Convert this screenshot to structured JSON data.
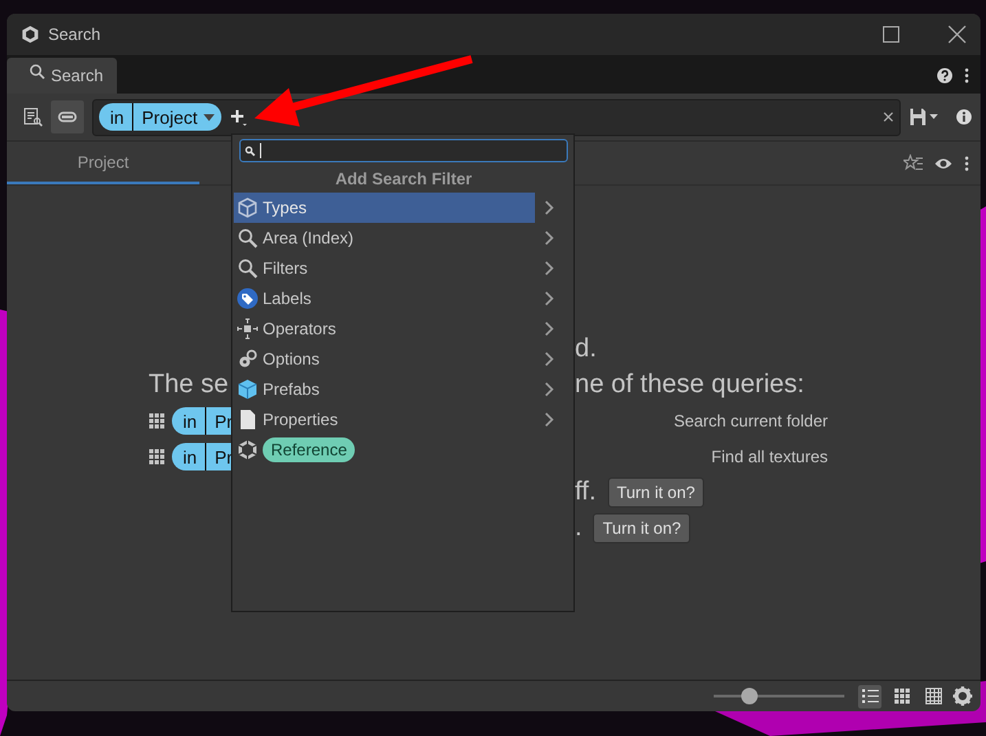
{
  "window": {
    "title": "Search"
  },
  "tabs": [
    {
      "label": "Search",
      "selected": true
    }
  ],
  "search_bar": {
    "scope_chip": {
      "prefix": "in",
      "value": "Project"
    }
  },
  "result_tabs": [
    {
      "label": "Project",
      "selected": true
    }
  ],
  "content": {
    "rows": [
      {
        "kind": "text",
        "right": "d."
      },
      {
        "kind": "heading",
        "left": "The se",
        "right": "ne of these queries:"
      },
      {
        "kind": "query",
        "chip_prefix": "in",
        "chip_value": "Pr",
        "right": "Search current folder"
      },
      {
        "kind": "query",
        "chip_prefix": "in",
        "chip_value": "Pr",
        "right": "Find all textures"
      },
      {
        "kind": "action",
        "right": "ff.",
        "button": "Turn it on?"
      },
      {
        "kind": "action",
        "right": ".",
        "button": "Turn it on?"
      }
    ]
  },
  "filter_menu": {
    "search": {
      "focused": true
    },
    "title": "Add Search Filter",
    "items": [
      {
        "label": "Types",
        "kind": "submenu",
        "selected": true
      },
      {
        "label": "Area (Index)",
        "kind": "submenu",
        "selected": false
      },
      {
        "label": "Filters",
        "kind": "submenu",
        "selected": false
      },
      {
        "label": "Labels",
        "kind": "submenu",
        "selected": false
      },
      {
        "label": "Operators",
        "kind": "submenu",
        "selected": false
      },
      {
        "label": "Options",
        "kind": "submenu",
        "selected": false
      },
      {
        "label": "Prefabs",
        "kind": "submenu",
        "selected": false
      },
      {
        "label": "Properties",
        "kind": "submenu",
        "selected": false
      },
      {
        "label": "Reference",
        "kind": "chip",
        "selected": false
      }
    ]
  },
  "status_bar": {
    "zoom": {
      "level": 0.27
    },
    "views": [
      {
        "selected": true
      },
      {
        "selected": false
      },
      {
        "selected": false
      }
    ]
  }
}
